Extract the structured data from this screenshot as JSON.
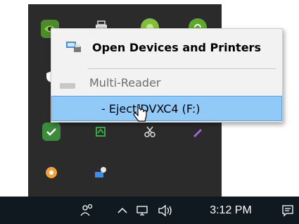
{
  "context_menu": {
    "items": [
      {
        "label": "Open Devices and Printers",
        "icon": "devices-printers-icon"
      },
      {
        "label": "Multi-Reader",
        "icon": "drive-icon"
      },
      {
        "label": "- Eject DVXC4 (F:)"
      }
    ]
  },
  "taskbar": {
    "clock": "3:12 PM",
    "icons": [
      "people-icon",
      "chevron-up-icon",
      "network-icon",
      "volume-icon",
      "action-center-icon"
    ]
  },
  "colors": {
    "flyout_bg": "#2b2b2b",
    "menu_bg": "#f2f2f2",
    "selection": "#91c9f7",
    "taskbar_bg": "#101820"
  }
}
